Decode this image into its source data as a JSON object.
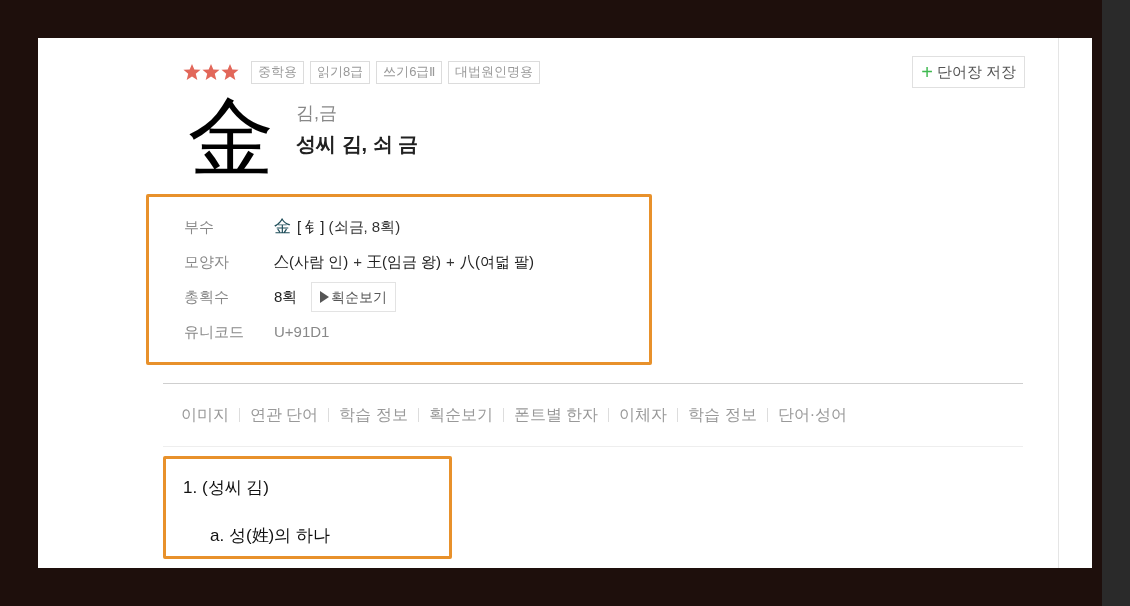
{
  "header": {
    "stars": 3,
    "tags": [
      "중학용",
      "읽기8급",
      "쓰기6급Ⅱ",
      "대법원인명용"
    ],
    "save_button": {
      "icon": "+",
      "label": "단어장 저장"
    }
  },
  "character": {
    "glyph": "金",
    "readings": "김,금",
    "meaning": "성씨 김, 쇠 금"
  },
  "info": [
    {
      "kind": "radical",
      "label": "부수",
      "glyph": "金",
      "bracket": "[ 钅]",
      "text": "(쇠금, 8획)"
    },
    {
      "kind": "parts",
      "label": "모양자",
      "parts": [
        {
          "glyph": "亼",
          "text": "(사람 인)"
        },
        {
          "glyph": "王",
          "text": "(임금 왕)"
        },
        {
          "glyph": "八",
          "text": "(여덟 팔)"
        }
      ],
      "joiner": "+"
    },
    {
      "kind": "strokes",
      "label": "총획수",
      "value": "8획",
      "button": "획순보기"
    },
    {
      "kind": "plain",
      "label": "유니코드",
      "value": "U+91D1"
    }
  ],
  "nav": [
    "이미지",
    "연관 단어",
    "학습 정보",
    "획순보기",
    "폰트별 한자",
    "이체자",
    "학습 정보",
    "단어·성어"
  ],
  "definitions": [
    {
      "number": "1.",
      "title": "(성씨 김)",
      "senses": [
        {
          "letter": "a.",
          "text": "성(姓)의 하나"
        }
      ]
    }
  ]
}
